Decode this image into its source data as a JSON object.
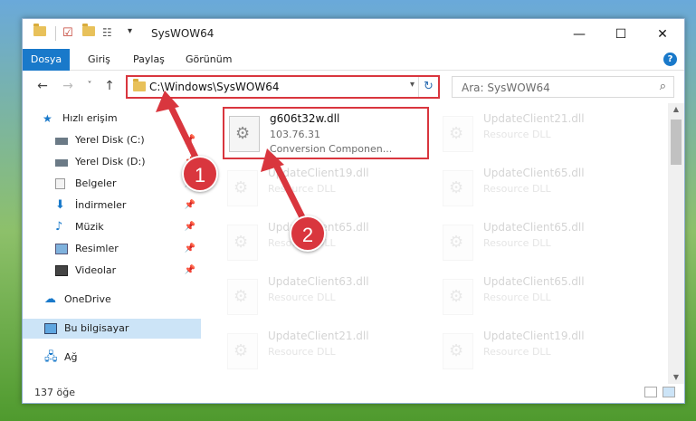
{
  "window": {
    "title": "SysWOW64",
    "buttons": {
      "minimize": "—",
      "maximize": "☐",
      "close": "✕"
    }
  },
  "ribbon": {
    "tabs": [
      {
        "label": "Dosya",
        "active": true
      },
      {
        "label": "Giriş"
      },
      {
        "label": "Paylaş"
      },
      {
        "label": "Görünüm"
      }
    ],
    "help": "?"
  },
  "nav": {
    "back": "←",
    "forward": "→",
    "recent": "˅",
    "up": "↑",
    "address": "C:\\Windows\\SysWOW64",
    "refresh": "↻",
    "search_placeholder": "Ara: SysWOW64"
  },
  "sidebar": {
    "items": [
      {
        "label": "Hızlı erişim",
        "icon": "star-icon",
        "pinned": false
      },
      {
        "label": "Yerel Disk (C:)",
        "icon": "drive-icon",
        "pinned": true
      },
      {
        "label": "Yerel Disk (D:)",
        "icon": "drive-icon",
        "pinned": true
      },
      {
        "label": "Belgeler",
        "icon": "document-icon",
        "pinned": true
      },
      {
        "label": "İndirmeler",
        "icon": "download-icon",
        "pinned": true
      },
      {
        "label": "Müzik",
        "icon": "music-icon",
        "pinned": true
      },
      {
        "label": "Resimler",
        "icon": "picture-icon",
        "pinned": true
      },
      {
        "label": "Videolar",
        "icon": "video-icon",
        "pinned": true
      },
      {
        "label": "OneDrive",
        "icon": "cloud-icon",
        "pinned": false
      },
      {
        "label": "Bu bilgisayar",
        "icon": "computer-icon",
        "pinned": false,
        "selected": true
      },
      {
        "label": "Ağ",
        "icon": "network-icon",
        "pinned": false
      }
    ]
  },
  "files": [
    {
      "name": "g606t32w.dll",
      "version": "103.76.31",
      "desc": "Conversion Componen...",
      "highlighted": true
    },
    {
      "name": "UpdateClient21.dll",
      "desc": "Resource DLL"
    },
    {
      "name": "UpdateClient19.dll",
      "desc": "Resource DLL"
    },
    {
      "name": "UpdateClient65.dll",
      "desc": "Resource DLL"
    },
    {
      "name": "UpdateClient65.dll",
      "desc": "Resource DLL"
    },
    {
      "name": "UpdateClient65.dll",
      "desc": "Resource DLL"
    },
    {
      "name": "UpdateClient63.dll",
      "desc": "Resource DLL"
    },
    {
      "name": "UpdateClient65.dll",
      "desc": "Resource DLL"
    },
    {
      "name": "UpdateClient21.dll",
      "desc": "Resource DLL"
    },
    {
      "name": "UpdateClient19.dll",
      "desc": "Resource DLL"
    }
  ],
  "status": {
    "count": "137 öğe"
  },
  "markers": [
    "1",
    "2"
  ],
  "colors": {
    "accent": "#1979ca",
    "highlight": "#d9363e"
  }
}
